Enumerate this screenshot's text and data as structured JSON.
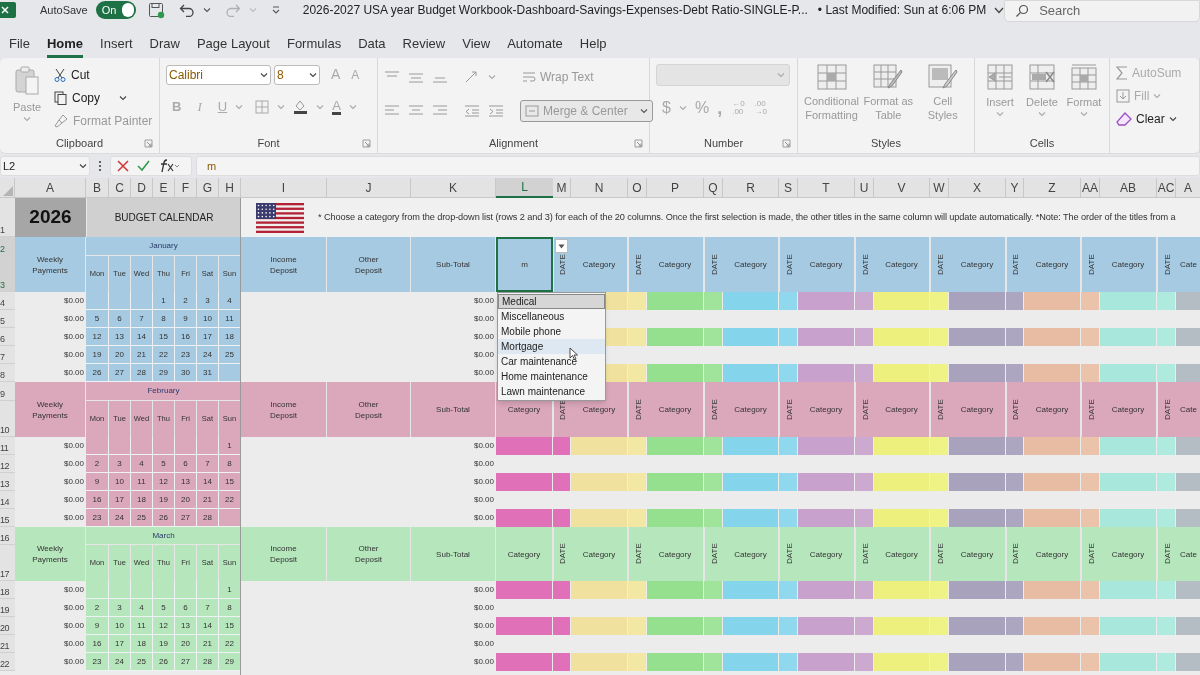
{
  "title_bar": {
    "autosave_label": "AutoSave",
    "autosave": {
      "label": "On",
      "on": true
    },
    "document_title": "2026-2027 USA year Budget Workbook-Dashboard-Savings-Expenses-Debt Ratio-SINGLE-P...",
    "last_modified": "• Last Modified: Sun at 6:06 PM",
    "search": {
      "placeholder": "Search"
    }
  },
  "menu_tabs": [
    {
      "label": "File",
      "selected": false
    },
    {
      "label": "Home",
      "selected": true
    },
    {
      "label": "Insert",
      "selected": false
    },
    {
      "label": "Draw",
      "selected": false
    },
    {
      "label": "Page Layout",
      "selected": false
    },
    {
      "label": "Formulas",
      "selected": false
    },
    {
      "label": "Data",
      "selected": false
    },
    {
      "label": "Review",
      "selected": false
    },
    {
      "label": "View",
      "selected": false
    },
    {
      "label": "Automate",
      "selected": false
    },
    {
      "label": "Help",
      "selected": false
    }
  ],
  "ribbon": {
    "clipboard": {
      "paste": "Paste",
      "cut": "Cut",
      "copy": "Copy",
      "format_painter": "Format Painter",
      "label": "Clipboard"
    },
    "font": {
      "font_name": "Calibri",
      "font_size": "8",
      "grow": "A",
      "shrink": "A",
      "bold": "B",
      "italic": "I",
      "underline": "U",
      "font_color": "A",
      "label": "Font"
    },
    "alignment": {
      "wrap_text": "Wrap Text",
      "merge": "Merge & Center",
      "label": "Alignment"
    },
    "number": {
      "currency": "$",
      "percent": "%",
      "comma": ",",
      "increase_decimal": {
        "top": "←0",
        "bottom": ".00"
      },
      "decrease_decimal": {
        "top": ".00",
        "bottom": "→0"
      },
      "label": "Number"
    },
    "styles": {
      "buttons": [
        "Conditional Formatting",
        "Format as Table",
        "Cell Styles"
      ],
      "label": "Styles"
    },
    "cells": {
      "buttons": [
        "Insert",
        "Delete",
        "Format"
      ],
      "label": "Cells"
    },
    "editing": {
      "autosum": "AutoSum",
      "fill": "Fill",
      "clear": "Clear"
    }
  },
  "formula_bar": {
    "name_box": "L2",
    "formula": "m"
  },
  "column_headers": [
    {
      "label": "A",
      "selected": false
    },
    {
      "label": "B",
      "selected": false
    },
    {
      "label": "C",
      "selected": false
    },
    {
      "label": "D",
      "selected": false
    },
    {
      "label": "E",
      "selected": false
    },
    {
      "label": "F",
      "selected": false
    },
    {
      "label": "G",
      "selected": false
    },
    {
      "label": "H",
      "selected": false
    },
    {
      "label": "I",
      "selected": false
    },
    {
      "label": "J",
      "selected": false
    },
    {
      "label": "K",
      "selected": false
    },
    {
      "label": "L",
      "selected": true
    },
    {
      "label": "M",
      "selected": false
    },
    {
      "label": "N",
      "selected": false
    },
    {
      "label": "O",
      "selected": false
    },
    {
      "label": "P",
      "selected": false
    },
    {
      "label": "Q",
      "selected": false
    },
    {
      "label": "R",
      "selected": false
    },
    {
      "label": "S",
      "selected": false
    },
    {
      "label": "T",
      "selected": false
    },
    {
      "label": "U",
      "selected": false
    },
    {
      "label": "V",
      "selected": false
    },
    {
      "label": "W",
      "selected": false
    },
    {
      "label": "X",
      "selected": false
    },
    {
      "label": "Y",
      "selected": false
    },
    {
      "label": "Z",
      "selected": false
    },
    {
      "label": "AA",
      "selected": false
    },
    {
      "label": "AB",
      "selected": false
    },
    {
      "label": "AC",
      "selected": false
    },
    {
      "label": "A",
      "selected": false
    }
  ],
  "row_headers": [
    {
      "label": "1",
      "selected": false
    },
    {
      "label": "2",
      "selected": true
    },
    {
      "label": "3",
      "selected": true
    },
    {
      "label": "4",
      "selected": false
    },
    {
      "label": "5",
      "selected": false
    },
    {
      "label": "6",
      "selected": false
    },
    {
      "label": "7",
      "selected": false
    },
    {
      "label": "8",
      "selected": false
    },
    {
      "label": "9",
      "selected": false
    },
    {
      "label": "10",
      "selected": false
    },
    {
      "label": "11",
      "selected": false
    },
    {
      "label": "12",
      "selected": false
    },
    {
      "label": "13",
      "selected": false
    },
    {
      "label": "14",
      "selected": false
    },
    {
      "label": "15",
      "selected": false
    },
    {
      "label": "16",
      "selected": false
    },
    {
      "label": "17",
      "selected": false
    },
    {
      "label": "18",
      "selected": false
    },
    {
      "label": "19",
      "selected": false
    },
    {
      "label": "20",
      "selected": false
    },
    {
      "label": "21",
      "selected": false
    },
    {
      "label": "22",
      "selected": false
    }
  ],
  "banner": {
    "year": "2026",
    "calendar_title": "BUDGET CALENDAR",
    "note": "* Choose a category from the drop-down list (rows 2 and 3) for each of the 20 columns. Once the first selection is made, the other titles in the same column will update automatically. *Note: The order of the titles from a"
  },
  "category_columns": [
    {
      "category": {
        "color": "#e070b8"
      },
      "date": {
        "color": "#e070b8"
      }
    },
    {
      "category": {
        "color": "#f0e29e"
      },
      "date": {
        "color": "#f3e7a4"
      }
    },
    {
      "category": {
        "color": "#94e08e"
      },
      "date": {
        "color": "#9fe49a"
      }
    },
    {
      "category": {
        "color": "#84d4ec"
      },
      "date": {
        "color": "#8fd8ee"
      }
    },
    {
      "category": {
        "color": "#c8a2cc"
      },
      "date": {
        "color": "#ccaad0"
      }
    },
    {
      "category": {
        "color": "#eef07e"
      },
      "date": {
        "color": "#eff285"
      }
    },
    {
      "category": {
        "color": "#a8a2bc"
      },
      "date": {
        "color": "#aca6c0"
      }
    },
    {
      "category": {
        "color": "#e8bca2"
      },
      "date": {
        "color": "#ebc2aa"
      }
    },
    {
      "category": {
        "color": "#a8e8dc"
      },
      "date": {
        "color": "#aeeade"
      }
    },
    {
      "category": {
        "color": "#b4bcc4"
      }
    }
  ],
  "months": [
    {
      "name": "January",
      "color": "#a6cae2",
      "weekly_payments": "Weekly Payments",
      "weekdays": [
        "Mon",
        "Tue",
        "Wed",
        "Thu",
        "Fri",
        "Sat",
        "Sun"
      ],
      "income": "Income Deposit",
      "other": "Other Deposit",
      "subtotal": "Sub-Total",
      "categories": [
        {
          "category": "m",
          "date": "DATE",
          "selected": true
        },
        {
          "category": "Category",
          "date": "DATE",
          "selected": false
        },
        {
          "category": "Category",
          "date": "DATE",
          "selected": false
        },
        {
          "category": "Category",
          "date": "DATE",
          "selected": false
        },
        {
          "category": "Category",
          "date": "DATE",
          "selected": false
        },
        {
          "category": "Category",
          "date": "DATE",
          "selected": false
        },
        {
          "category": "Category",
          "date": "DATE",
          "selected": false
        },
        {
          "category": "Category",
          "date": "DATE",
          "selected": false
        },
        {
          "category": "Category",
          "date": "DATE",
          "selected": false
        },
        {
          "category": "Cate",
          "selected": false
        }
      ],
      "weeks": [
        {
          "payment": "$0.00",
          "days": [
            {
              "kind": "blank"
            },
            {
              "kind": "blank"
            },
            {
              "kind": "blank"
            },
            {
              "kind": "date",
              "label": "1"
            },
            {
              "kind": "date",
              "label": "2"
            },
            {
              "kind": "date",
              "label": "3"
            },
            {
              "kind": "date",
              "label": "4"
            }
          ],
          "subtotal": "$0.00"
        },
        {
          "payment": "$0.00",
          "days": [
            {
              "kind": "date",
              "label": "5"
            },
            {
              "kind": "date",
              "label": "6"
            },
            {
              "kind": "date",
              "label": "7"
            },
            {
              "kind": "date",
              "label": "8"
            },
            {
              "kind": "date",
              "label": "9"
            },
            {
              "kind": "date",
              "label": "10"
            },
            {
              "kind": "date",
              "label": "11"
            }
          ],
          "subtotal": "$0.00"
        },
        {
          "payment": "$0.00",
          "days": [
            {
              "kind": "date",
              "label": "12"
            },
            {
              "kind": "date",
              "label": "13"
            },
            {
              "kind": "date",
              "label": "14"
            },
            {
              "kind": "date",
              "label": "15"
            },
            {
              "kind": "date",
              "label": "16"
            },
            {
              "kind": "date",
              "label": "17"
            },
            {
              "kind": "date",
              "label": "18"
            }
          ],
          "subtotal": "$0.00"
        },
        {
          "payment": "$0.00",
          "days": [
            {
              "kind": "date",
              "label": "19"
            },
            {
              "kind": "date",
              "label": "20"
            },
            {
              "kind": "date",
              "label": "21"
            },
            {
              "kind": "date",
              "label": "22"
            },
            {
              "kind": "date",
              "label": "23"
            },
            {
              "kind": "date",
              "label": "24"
            },
            {
              "kind": "date",
              "label": "25"
            }
          ],
          "subtotal": "$0.00"
        },
        {
          "payment": "$0.00",
          "days": [
            {
              "kind": "date",
              "label": "26"
            },
            {
              "kind": "date",
              "label": "27"
            },
            {
              "kind": "date",
              "label": "28"
            },
            {
              "kind": "date",
              "label": "29"
            },
            {
              "kind": "date",
              "label": "30"
            },
            {
              "kind": "date",
              "label": "31"
            },
            {
              "kind": "blank"
            }
          ],
          "subtotal": "$0.00"
        }
      ]
    },
    {
      "name": "February",
      "color": "#dba7ba",
      "weekly_payments": "Weekly Payments",
      "weekdays": [
        "Mon",
        "Tue",
        "Wed",
        "Thu",
        "Fri",
        "Sat",
        "Sun"
      ],
      "income": "Income Deposit",
      "other": "Other Deposit",
      "subtotal": "Sub-Total",
      "categories": [
        {
          "category": "Category",
          "date": "DATE",
          "selected": false
        },
        {
          "category": "Category",
          "date": "DATE",
          "selected": false
        },
        {
          "category": "Category",
          "date": "DATE",
          "selected": false
        },
        {
          "category": "Category",
          "date": "DATE",
          "selected": false
        },
        {
          "category": "Category",
          "date": "DATE",
          "selected": false
        },
        {
          "category": "Category",
          "date": "DATE",
          "selected": false
        },
        {
          "category": "Category",
          "date": "DATE",
          "selected": false
        },
        {
          "category": "Category",
          "date": "DATE",
          "selected": false
        },
        {
          "category": "Category",
          "date": "DATE",
          "selected": false
        },
        {
          "category": "Cate",
          "selected": false
        }
      ],
      "weeks": [
        {
          "payment": "$0.00",
          "days": [
            {
              "kind": "blank"
            },
            {
              "kind": "blank"
            },
            {
              "kind": "blank"
            },
            {
              "kind": "blank"
            },
            {
              "kind": "blank"
            },
            {
              "kind": "blank"
            },
            {
              "kind": "date",
              "label": "1"
            }
          ],
          "subtotal": "$0.00"
        },
        {
          "payment": "$0.00",
          "days": [
            {
              "kind": "date",
              "label": "2"
            },
            {
              "kind": "date",
              "label": "3"
            },
            {
              "kind": "date",
              "label": "4"
            },
            {
              "kind": "date",
              "label": "5"
            },
            {
              "kind": "date",
              "label": "6"
            },
            {
              "kind": "date",
              "label": "7"
            },
            {
              "kind": "date",
              "label": "8"
            }
          ],
          "subtotal": "$0.00"
        },
        {
          "payment": "$0.00",
          "days": [
            {
              "kind": "date",
              "label": "9"
            },
            {
              "kind": "date",
              "label": "10"
            },
            {
              "kind": "date",
              "label": "11"
            },
            {
              "kind": "date",
              "label": "12"
            },
            {
              "kind": "date",
              "label": "13"
            },
            {
              "kind": "date",
              "label": "14"
            },
            {
              "kind": "date",
              "label": "15"
            }
          ],
          "subtotal": "$0.00"
        },
        {
          "payment": "$0.00",
          "days": [
            {
              "kind": "date",
              "label": "16"
            },
            {
              "kind": "date",
              "label": "17"
            },
            {
              "kind": "date",
              "label": "18"
            },
            {
              "kind": "date",
              "label": "19"
            },
            {
              "kind": "date",
              "label": "20"
            },
            {
              "kind": "date",
              "label": "21"
            },
            {
              "kind": "date",
              "label": "22"
            }
          ],
          "subtotal": "$0.00"
        },
        {
          "payment": "$0.00",
          "days": [
            {
              "kind": "date",
              "label": "23"
            },
            {
              "kind": "date",
              "label": "24"
            },
            {
              "kind": "date",
              "label": "25"
            },
            {
              "kind": "date",
              "label": "26"
            },
            {
              "kind": "date",
              "label": "27"
            },
            {
              "kind": "date",
              "label": "28"
            },
            {
              "kind": "blank"
            }
          ],
          "subtotal": "$0.00"
        }
      ]
    },
    {
      "name": "March",
      "color": "#b6e6bc",
      "weekly_payments": "Weekly Payments",
      "weekdays": [
        "Mon",
        "Tue",
        "Wed",
        "Thu",
        "Fri",
        "Sat",
        "Sun"
      ],
      "income": "Income Deposit",
      "other": "Other Deposit",
      "subtotal": "Sub-Total",
      "categories": [
        {
          "category": "Category",
          "date": "DATE",
          "selected": false
        },
        {
          "category": "Category",
          "date": "DATE",
          "selected": false
        },
        {
          "category": "Category",
          "date": "DATE",
          "selected": false
        },
        {
          "category": "Category",
          "date": "DATE",
          "selected": false
        },
        {
          "category": "Category",
          "date": "DATE",
          "selected": false
        },
        {
          "category": "Category",
          "date": "DATE",
          "selected": false
        },
        {
          "category": "Category",
          "date": "DATE",
          "selected": false
        },
        {
          "category": "Category",
          "date": "DATE",
          "selected": false
        },
        {
          "category": "Category",
          "date": "DATE",
          "selected": false
        },
        {
          "category": "Cate",
          "selected": false
        }
      ],
      "weeks": [
        {
          "payment": "$0.00",
          "days": [
            {
              "kind": "blank"
            },
            {
              "kind": "blank"
            },
            {
              "kind": "blank"
            },
            {
              "kind": "blank"
            },
            {
              "kind": "blank"
            },
            {
              "kind": "blank"
            },
            {
              "kind": "date",
              "label": "1"
            }
          ],
          "subtotal": "$0.00"
        },
        {
          "payment": "$0.00",
          "days": [
            {
              "kind": "date",
              "label": "2"
            },
            {
              "kind": "date",
              "label": "3"
            },
            {
              "kind": "date",
              "label": "4"
            },
            {
              "kind": "date",
              "label": "5"
            },
            {
              "kind": "date",
              "label": "6"
            },
            {
              "kind": "date",
              "label": "7"
            },
            {
              "kind": "date",
              "label": "8"
            }
          ],
          "subtotal": "$0.00"
        },
        {
          "payment": "$0.00",
          "days": [
            {
              "kind": "date",
              "label": "9"
            },
            {
              "kind": "date",
              "label": "10"
            },
            {
              "kind": "date",
              "label": "11"
            },
            {
              "kind": "date",
              "label": "12"
            },
            {
              "kind": "date",
              "label": "13"
            },
            {
              "kind": "date",
              "label": "14"
            },
            {
              "kind": "date",
              "label": "15"
            }
          ],
          "subtotal": "$0.00"
        },
        {
          "payment": "$0.00",
          "days": [
            {
              "kind": "date",
              "label": "16"
            },
            {
              "kind": "date",
              "label": "17"
            },
            {
              "kind": "date",
              "label": "18"
            },
            {
              "kind": "date",
              "label": "19"
            },
            {
              "kind": "date",
              "label": "20"
            },
            {
              "kind": "date",
              "label": "21"
            },
            {
              "kind": "date",
              "label": "22"
            }
          ],
          "subtotal": "$0.00"
        },
        {
          "payment": "$0.00",
          "days": [
            {
              "kind": "date",
              "label": "23"
            },
            {
              "kind": "date",
              "label": "24"
            },
            {
              "kind": "date",
              "label": "25"
            },
            {
              "kind": "date",
              "label": "26"
            },
            {
              "kind": "date",
              "label": "27"
            },
            {
              "kind": "date",
              "label": "28"
            },
            {
              "kind": "date",
              "label": "29"
            }
          ],
          "subtotal": "$0.00"
        }
      ]
    }
  ],
  "dropdown": {
    "options": [
      {
        "label": "Medical",
        "selected": true,
        "hovered": false
      },
      {
        "label": "Miscellaneous",
        "selected": false,
        "hovered": false
      },
      {
        "label": "Mobile phone",
        "selected": false,
        "hovered": false
      },
      {
        "label": "Mortgage",
        "selected": false,
        "hovered": true
      },
      {
        "label": "Car maintenance",
        "selected": false,
        "hovered": false
      },
      {
        "label": "Home maintenance",
        "selected": false,
        "hovered": false
      },
      {
        "label": "Lawn maintenance",
        "selected": false,
        "hovered": false
      }
    ]
  }
}
